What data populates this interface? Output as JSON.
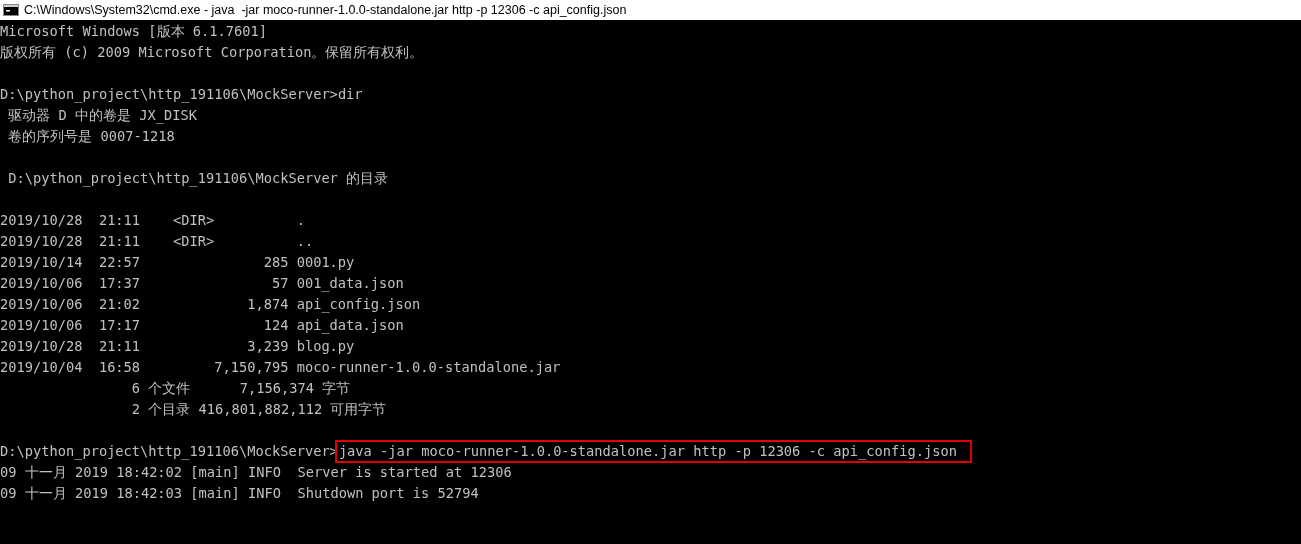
{
  "window": {
    "title": "C:\\Windows\\System32\\cmd.exe - java  -jar moco-runner-1.0.0-standalone.jar http -p 12306 -c api_config.json"
  },
  "console": {
    "blocks": [
      {
        "lines": [
          {
            "kind": "output",
            "text": "Microsoft Windows [版本 6.1.7601]"
          },
          {
            "kind": "output",
            "text": "版权所有 (c) 2009 Microsoft Corporation。保留所有权利。"
          }
        ]
      },
      {
        "lines": [
          {
            "kind": "input",
            "prompt": "D:\\python_project\\http_191106\\MockServer>",
            "command": "dir",
            "highlighted": false
          },
          {
            "kind": "output",
            "text": " 驱动器 D 中的卷是 JX_DISK"
          },
          {
            "kind": "output",
            "text": " 卷的序列号是 0007-1218"
          }
        ]
      },
      {
        "lines": [
          {
            "kind": "output",
            "text": " D:\\python_project\\http_191106\\MockServer 的目录"
          }
        ]
      },
      {
        "lines": [
          {
            "kind": "output",
            "text": "2019/10/28  21:11    <DIR>          ."
          },
          {
            "kind": "output",
            "text": "2019/10/28  21:11    <DIR>          .."
          },
          {
            "kind": "output",
            "text": "2019/10/14  22:57               285 0001.py"
          },
          {
            "kind": "output",
            "text": "2019/10/06  17:37                57 001_data.json"
          },
          {
            "kind": "output",
            "text": "2019/10/06  21:02             1,874 api_config.json"
          },
          {
            "kind": "output",
            "text": "2019/10/06  17:17               124 api_data.json"
          },
          {
            "kind": "output",
            "text": "2019/10/28  21:11             3,239 blog.py"
          },
          {
            "kind": "output",
            "text": "2019/10/04  16:58         7,150,795 moco-runner-1.0.0-standalone.jar"
          },
          {
            "kind": "output",
            "text": "                6 个文件      7,156,374 字节"
          },
          {
            "kind": "output",
            "text": "                2 个目录 416,801,882,112 可用字节"
          }
        ]
      },
      {
        "lines": [
          {
            "kind": "input",
            "prompt": "D:\\python_project\\http_191106\\MockServer>",
            "command": "java -jar moco-runner-1.0.0-standalone.jar http -p 12306 -c api_config.json",
            "highlighted": true
          },
          {
            "kind": "output",
            "text": "09 十一月 2019 18:42:02 [main] INFO  Server is started at 12306"
          },
          {
            "kind": "output",
            "text": "09 十一月 2019 18:42:03 [main] INFO  Shutdown port is 52794"
          }
        ]
      }
    ]
  }
}
